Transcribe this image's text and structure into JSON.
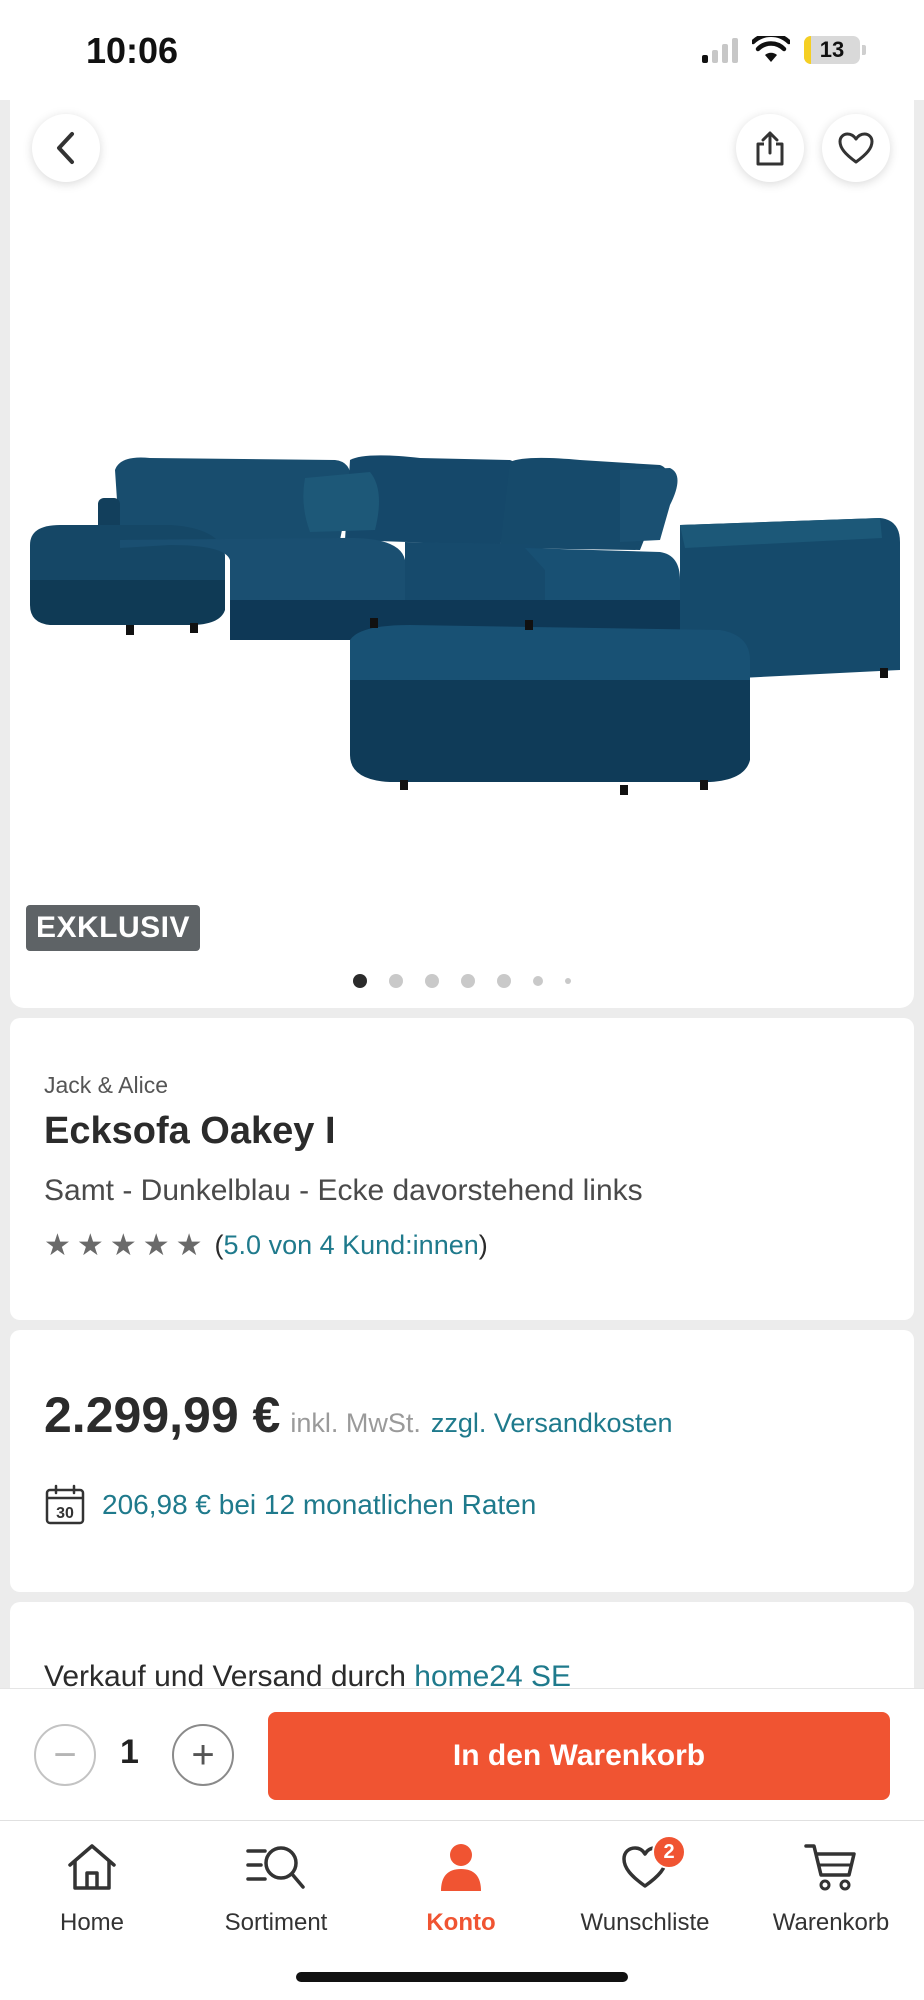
{
  "status_bar": {
    "time": "10:06",
    "battery": "13",
    "battery_level": 0.13
  },
  "product_image": {
    "badge": "EXKLUSIV",
    "image_count": 7,
    "active_index": 0
  },
  "product": {
    "brand": "Jack & Alice",
    "title": "Ecksofa Oakey I",
    "variant": "Samt - Dunkelblau - Ecke davorstehend links",
    "rating_stars": 5,
    "rating_text": "5.0 von 4 Kund:innen",
    "rating_paren_open": "(",
    "rating_paren_close": ")"
  },
  "price": {
    "amount": "2.299,99 €",
    "vat_note": "inkl. MwSt.",
    "shipping_link": "zzgl. Versandkosten",
    "calendar_day": "30",
    "installment": "206,98 € bei 12 monatlichen Raten"
  },
  "seller": {
    "prefix": "Verkauf und Versand durch",
    "name": "home24 SE"
  },
  "cart": {
    "quantity": "1",
    "minus_symbol": "−",
    "plus_symbol": "+",
    "add_to_cart": "In den Warenkorb"
  },
  "nav": {
    "items": [
      {
        "label": "Home",
        "icon": "home-icon"
      },
      {
        "label": "Sortiment",
        "icon": "catalog-search-icon"
      },
      {
        "label": "Konto",
        "icon": "account-icon"
      },
      {
        "label": "Wunschliste",
        "icon": "wishlist-icon"
      },
      {
        "label": "Warenkorb",
        "icon": "cart-icon"
      }
    ],
    "active": "Konto",
    "wishlist_badge": "2"
  },
  "colors": {
    "accent": "#f05432",
    "link": "#1f7a8c",
    "sofa": "#0f3f5f"
  }
}
